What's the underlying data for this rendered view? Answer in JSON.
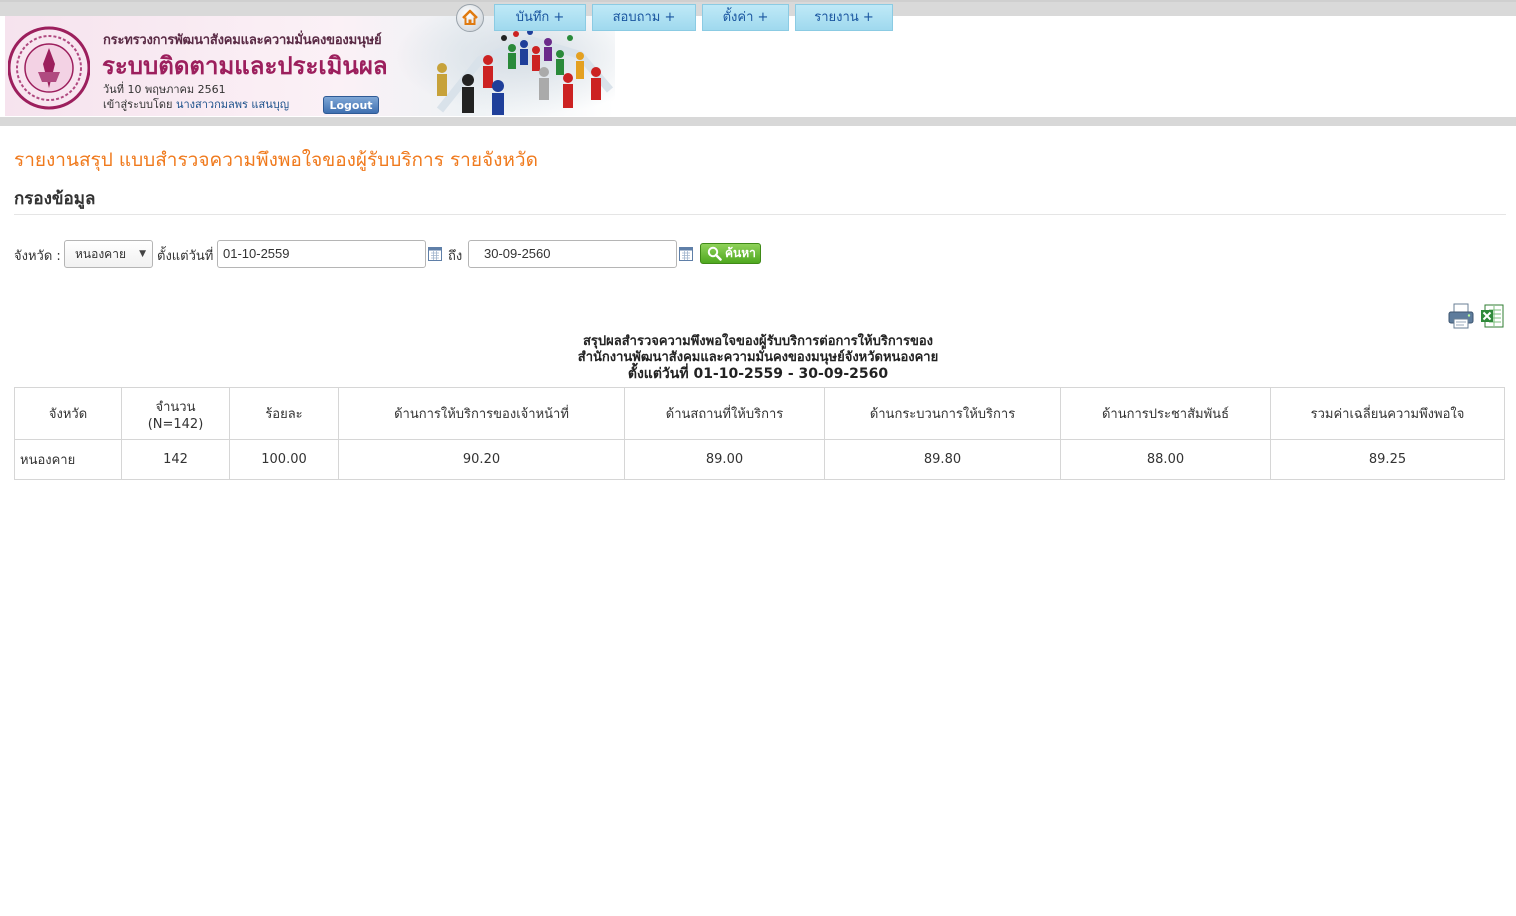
{
  "header": {
    "ministry": "กระทรวงการพัฒนาสังคมและความมั่นคงของมนุษย์",
    "system_title": "ระบบติดตามและประเมินผล",
    "date_line": "วันที่ 10 พฤษภาคม 2561",
    "login_prefix": "เข้าสู่ระบบโดย",
    "user_name": "นางสาวกมลพร แสนบุญ",
    "logout_label": "Logout"
  },
  "menu": {
    "items": [
      {
        "label": "บันทึก +"
      },
      {
        "label": "สอบถาม +"
      },
      {
        "label": "ตั้งค่า +"
      },
      {
        "label": "รายงาน +"
      }
    ]
  },
  "page": {
    "title": "รายงานสรุป แบบสำรวจความพึงพอใจของผู้รับบริการ รายจังหวัด",
    "filter_heading": "กรองข้อมูล"
  },
  "filter": {
    "province_label": "จังหวัด :",
    "province_value": "หนองคาย",
    "from_label": "ตั้งแต่วันที่",
    "from_value": "01-10-2559",
    "to_label": "ถึง",
    "to_value": "30-09-2560",
    "search_label": "ค้นหา"
  },
  "report": {
    "title_line1": "สรุปผลสำรวจความพึงพอใจของผู้รับบริการต่อการให้บริการของ",
    "title_line2": "สำนักงานพัฒนาสังคมและความมั่นคงของมนุษย์จังหวัดหนองคาย",
    "title_line3": "ตั้งแต่วันที่ 01-10-2559 - 30-09-2560",
    "columns": {
      "province": "จังหวัด",
      "count_line1": "จำนวน",
      "count_line2": "(N=142)",
      "percent": "ร้อยละ",
      "staff": "ด้านการให้บริการของเจ้าหน้าที่",
      "place": "ด้านสถานที่ให้บริการ",
      "process": "ด้านกระบวนการให้บริการ",
      "pr": "ด้านการประชาสัมพันธ์",
      "average": "รวมค่าเฉลี่ยนความพึงพอใจ"
    },
    "rows": [
      {
        "province": "หนองคาย",
        "count": "142",
        "percent": "100.00",
        "staff": "90.20",
        "place": "89.00",
        "process": "89.80",
        "pr": "88.00",
        "average": "89.25"
      }
    ]
  },
  "icons": {
    "home": "home-icon",
    "print": "printer-icon",
    "excel": "excel-icon",
    "calendar": "calendar-icon",
    "search": "magnifier-icon"
  },
  "colors": {
    "page_title": "#f07a1d",
    "system_title": "#9c1f5d",
    "menu_tab": "#bfe9f7",
    "search_button": "#4fa81f"
  }
}
